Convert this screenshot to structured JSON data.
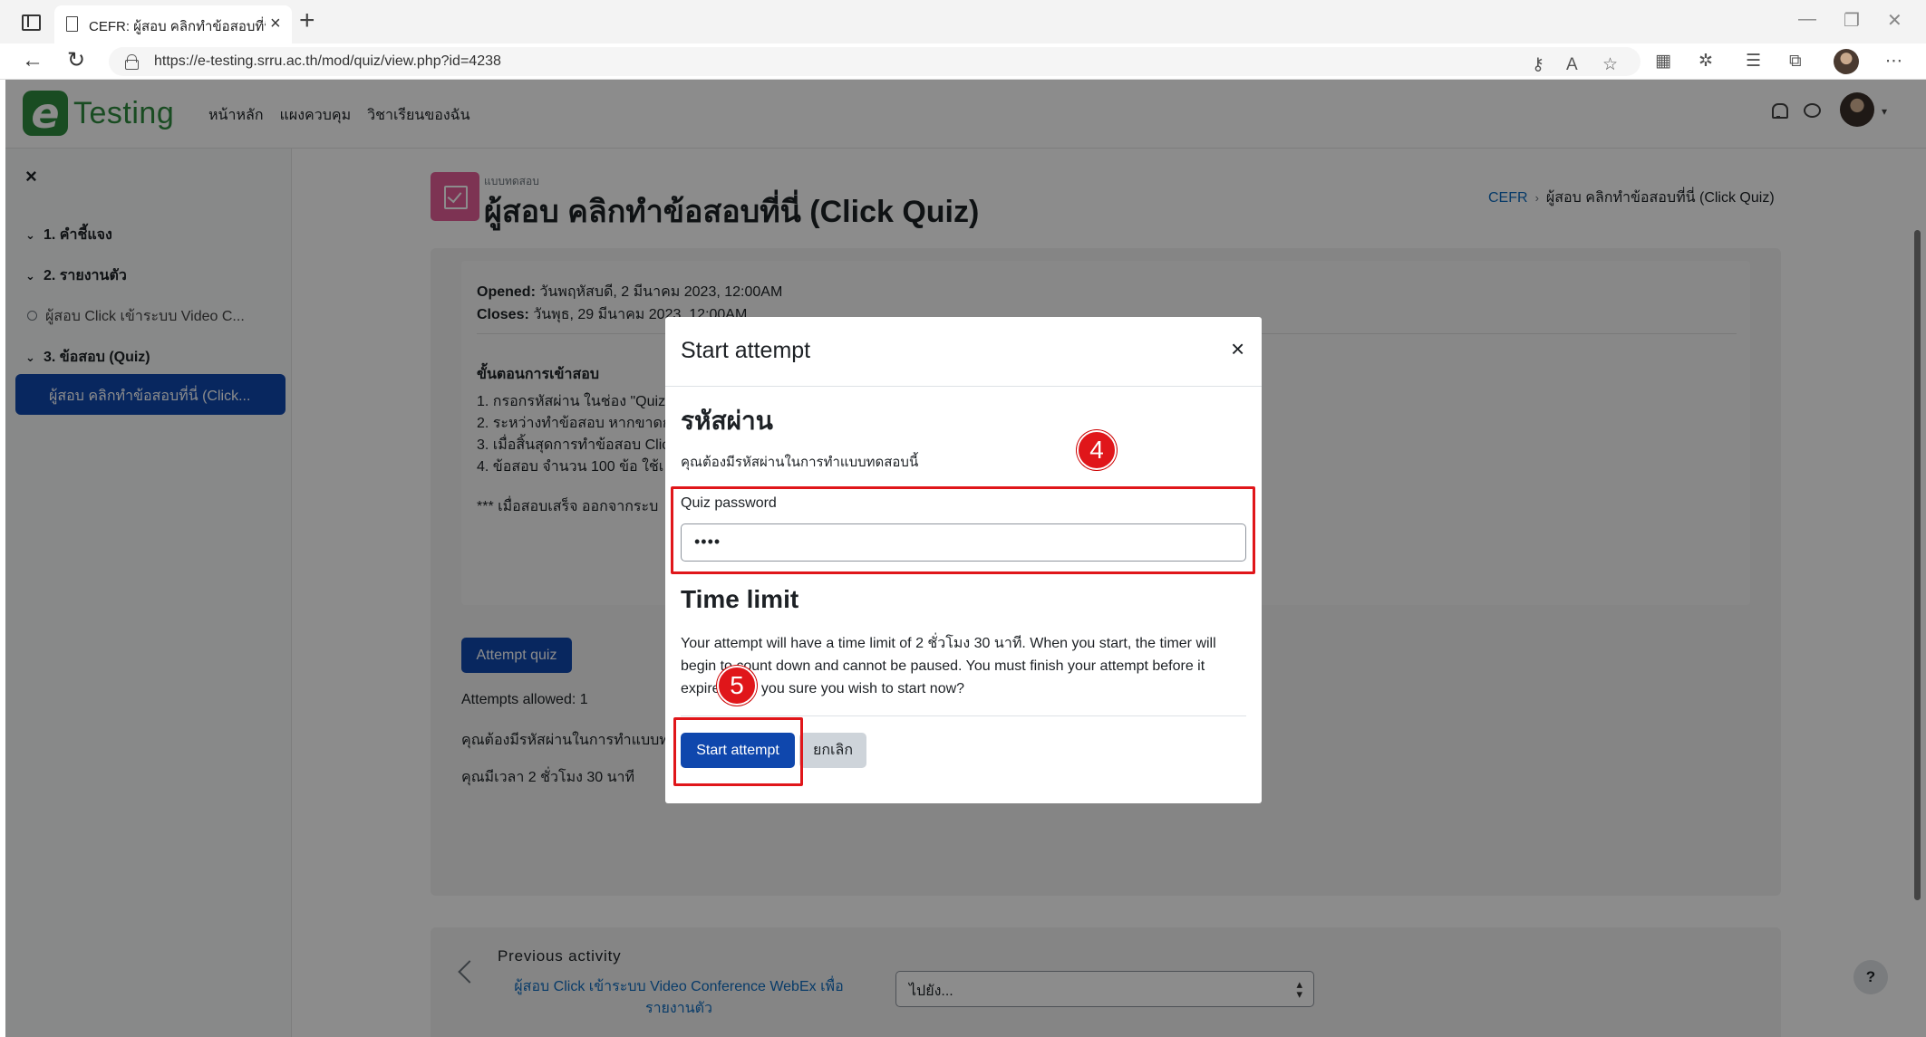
{
  "browser": {
    "tab_title": "CEFR: ผู้สอบ คลิกทำข้อสอบที่นี่ (Click Quiz)",
    "url": "https://e-testing.srru.ac.th/mod/quiz/view.php?id=4238"
  },
  "site": {
    "logo_letter": "e",
    "logo_text": "Testing",
    "nav": [
      "หน้าหลัก",
      "แผงควบคุม",
      "วิชาเรียนของฉัน"
    ]
  },
  "sidebar": {
    "items": [
      {
        "label": "1. คำชี้แจง",
        "type": "section"
      },
      {
        "label": "2. รายงานตัว",
        "type": "section"
      },
      {
        "label": "ผู้สอบ Click เข้าระบบ Video C...",
        "type": "activity"
      },
      {
        "label": "3. ข้อสอบ (Quiz)",
        "type": "section"
      }
    ],
    "active_item": "ผู้สอบ คลิกทำข้อสอบที่นี่ (Click..."
  },
  "page": {
    "activity_type": "แบบทดสอบ",
    "title": "ผู้สอบ คลิกทำข้อสอบที่นี่ (Click Quiz)",
    "breadcrumb": [
      "CEFR",
      "ผู้สอบ คลิกทำข้อสอบที่นี่ (Click Quiz)"
    ],
    "opened_label": "Opened:",
    "opened_value": "วันพฤหัสบดี, 2 มีนาคม 2023, 12:00AM",
    "closes_label": "Closes:",
    "closes_value": "วันพุธ, 29 มีนาคม 2023, 12:00AM",
    "steps_title": "ขั้นตอนการเข้าสอบ",
    "steps": [
      "1. กรอกรหัสผ่าน ในช่อง \"Quiz p",
      "2. ระหว่างทำข้อสอบ หากขาดก",
      "3. เมื่อสิ้นสุดการทำข้อสอบ Click",
      "4. ข้อสอบ จำนวน 100 ข้อ  ใช้เ"
    ],
    "note": "*** เมื่อสอบเสร็จ ออกจากระบ",
    "attempt_button": "Attempt quiz",
    "attempts_allowed": "Attempts allowed: 1",
    "password_required": "คุณต้องมีรหัสผ่านในการทำแบบทด",
    "time_allowed": "คุณมีเวลา 2 ชั่วโมง 30 นาที",
    "prev_activity_label": "Previous activity",
    "prev_activity_link": "ผู้สอบ Click เข้าระบบ Video Conference WebEx เพื่อรายงานตัว",
    "jump_select": "ไปยัง...",
    "help": "?"
  },
  "modal": {
    "title": "Start attempt",
    "password_heading": "รหัสผ่าน",
    "password_desc": "คุณต้องมีรหัสผ่านในการทำแบบทดสอบนี้",
    "password_label": "Quiz password",
    "password_value": "••••",
    "time_heading": "Time limit",
    "time_text": "Your attempt will have a time limit of 2 ชั่วโมง 30 นาที. When you start, the timer will begin to count down and cannot be paused. You must finish your attempt before it expires. Are you sure you wish to start now?",
    "start_button": "Start attempt",
    "cancel_button": "ยกเลิก"
  },
  "annotations": {
    "step4": "4",
    "step5": "5",
    "color": "#e0161a"
  },
  "colors": {
    "primary": "#0f47ad",
    "link": "#0f6cbf",
    "logo_green": "#2e8b3e",
    "quiz_icon": "#e35e98"
  }
}
